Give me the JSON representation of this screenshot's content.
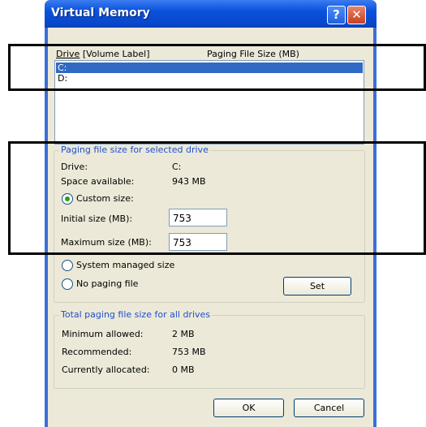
{
  "window": {
    "title": "Virtual Memory",
    "help_glyph": "?",
    "close_glyph": "✕"
  },
  "drive_list": {
    "header_drive": "Drive",
    "header_drive_suffix": " [Volume Label]",
    "header_size": "Paging File Size (MB)",
    "rows": [
      {
        "drive": "C:",
        "selected": true
      },
      {
        "drive": "D:",
        "selected": false
      }
    ]
  },
  "selected_drive_group": {
    "title": "Paging file size for selected drive",
    "drive_label": "Drive:",
    "drive_value": "C:",
    "space_label": "Space available:",
    "space_value": "943 MB",
    "custom_size_label": "Custom size:",
    "initial_label": "Initial size (MB):",
    "initial_value": "753",
    "maximum_label": "Maximum size (MB):",
    "maximum_value": "753",
    "system_managed_label": "System managed size",
    "no_paging_label": "No paging file",
    "set_label": "Set"
  },
  "total_group": {
    "title": "Total paging file size for all drives",
    "min_label": "Minimum allowed:",
    "min_value": "2 MB",
    "rec_label": "Recommended:",
    "rec_value": "753 MB",
    "alloc_label": "Currently allocated:",
    "alloc_value": "0 MB"
  },
  "buttons": {
    "ok": "OK",
    "cancel": "Cancel"
  }
}
